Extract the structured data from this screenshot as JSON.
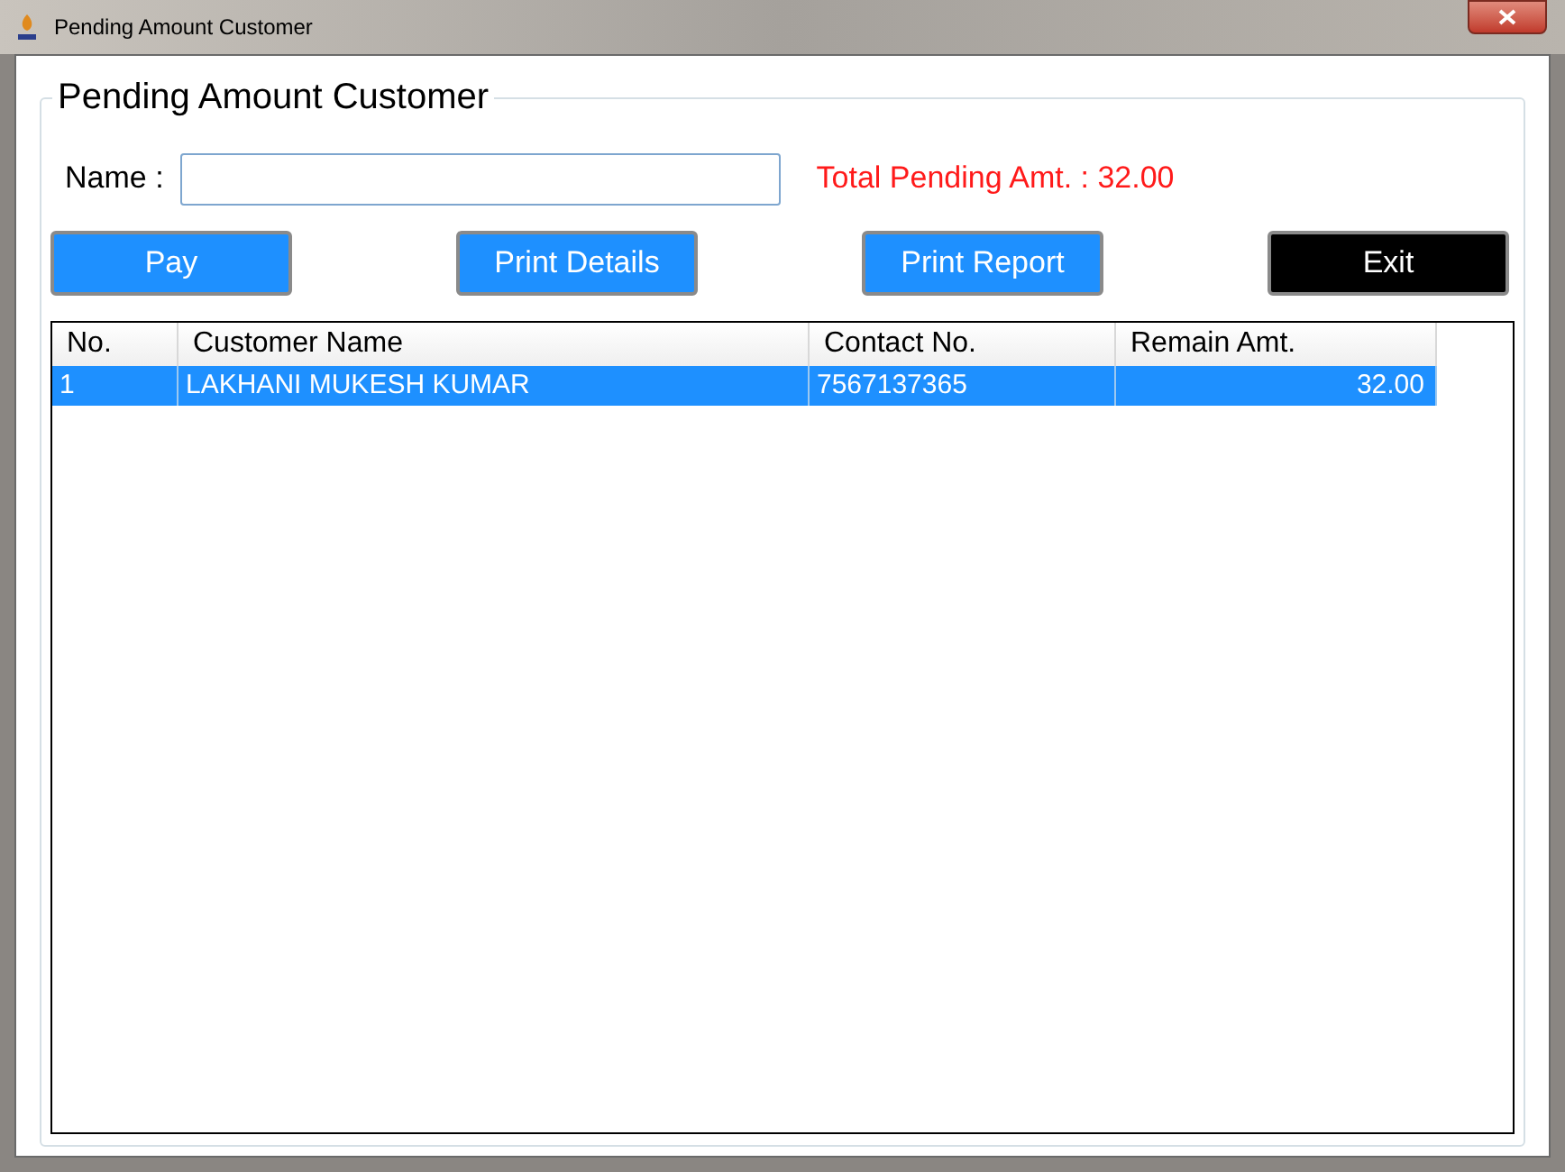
{
  "window": {
    "title": "Pending Amount Customer"
  },
  "group": {
    "title": "Pending Amount Customer"
  },
  "name_field": {
    "label": "Name :"
  },
  "total": {
    "text": "Total Pending Amt. : 32.00"
  },
  "buttons": [
    {
      "label": "Pay",
      "kind": "primary"
    },
    {
      "label": "Print Details",
      "kind": "primary"
    },
    {
      "label": "Print Report",
      "kind": "primary"
    },
    {
      "label": "Exit",
      "kind": "dark"
    }
  ],
  "table": {
    "columns": [
      "No.",
      "Customer Name",
      "Contact No.",
      "Remain Amt."
    ],
    "rows": [
      {
        "cells": [
          "1",
          "LAKHANI MUKESH KUMAR",
          "7567137365",
          "32.00"
        ],
        "selected": true
      }
    ]
  }
}
